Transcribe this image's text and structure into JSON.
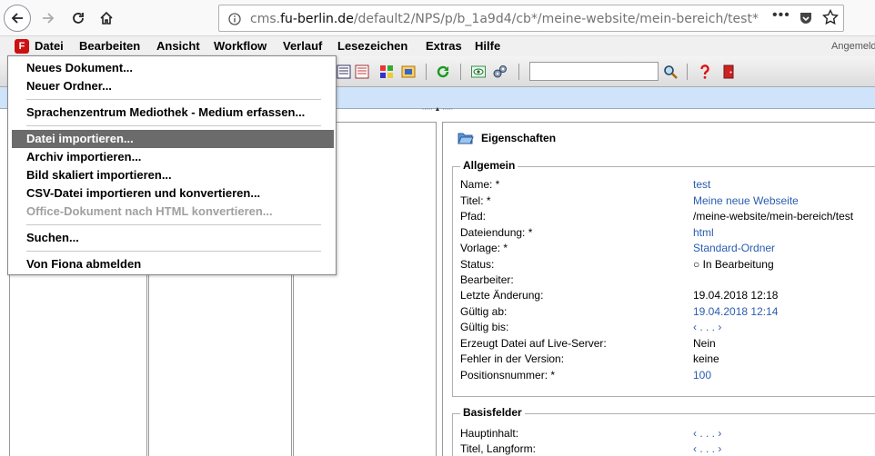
{
  "browser": {
    "url_prefix": "cms.",
    "url_host": "fu-berlin.de",
    "url_path": "/default2/NPS/p/b_1a9d4/cb*/meine-website/mein-bereich/test*",
    "page_actions": "•••"
  },
  "menubar": {
    "items": [
      "Datei",
      "Bearbeiten",
      "Ansicht",
      "Workflow",
      "Verlauf",
      "Lesezeichen",
      "Extras",
      "Hilfe"
    ],
    "user_label": "Angemeldet"
  },
  "toolbar": {
    "search_value": "",
    "splitter_glyph": "····· ▲ ·····"
  },
  "dropdown": {
    "items": [
      {
        "label": "Neues Dokument...",
        "state": "normal"
      },
      {
        "label": "Neuer Ordner...",
        "state": "normal"
      },
      {
        "label": "Sprachenzentrum Mediothek - Medium erfassen...",
        "state": "normal"
      },
      {
        "label": "Datei importieren...",
        "state": "active"
      },
      {
        "label": "Archiv importieren...",
        "state": "normal"
      },
      {
        "label": "Bild skaliert importieren...",
        "state": "normal"
      },
      {
        "label": "CSV-Datei importieren und konvertieren...",
        "state": "normal"
      },
      {
        "label": "Office-Dokument nach HTML konvertieren...",
        "state": "disabled"
      },
      {
        "label": "Suchen...",
        "state": "normal"
      },
      {
        "label": "Von Fiona abmelden",
        "state": "normal"
      }
    ]
  },
  "properties": {
    "title": "Eigenschaften",
    "allgemein": {
      "legend": "Allgemein",
      "rows": [
        {
          "label": "Name: *",
          "value": "test",
          "link": true
        },
        {
          "label": "Titel: *",
          "value": "Meine neue Webseite",
          "link": true
        },
        {
          "label": "Pfad:",
          "value": "/meine-website/mein-bereich/test",
          "link": false
        },
        {
          "label": "Dateiendung: *",
          "value": "html",
          "link": true
        },
        {
          "label": "Vorlage: *",
          "value": "Standard-Ordner",
          "link": true
        },
        {
          "label": "Status:",
          "value": "○ In Bearbeitung",
          "link": false
        },
        {
          "label": "Bearbeiter:",
          "value": "",
          "link": false
        },
        {
          "label": "Letzte Änderung:",
          "value": "19.04.2018 12:18",
          "link": false
        },
        {
          "label": "Gültig ab:",
          "value": "19.04.2018 12:14",
          "link": true
        },
        {
          "label": "Gültig bis:",
          "value": "‹ . . . ›",
          "link": true
        },
        {
          "label": "Erzeugt Datei auf Live-Server:",
          "value": "Nein",
          "link": false
        },
        {
          "label": "Fehler in der Version:",
          "value": "keine",
          "link": false
        },
        {
          "label": "Positionsnummer: *",
          "value": "100",
          "link": true
        }
      ]
    },
    "basisfelder": {
      "legend": "Basisfelder",
      "rows": [
        {
          "label": "Hauptinhalt:",
          "value": "‹ . . . ›",
          "link": true
        },
        {
          "label": "Titel, Langform:",
          "value": "‹ . . . ›",
          "link": true
        }
      ]
    }
  },
  "colors": {
    "accent": "#2a5db0",
    "menu_active": "#6b6b6b",
    "strip": "#cfe4fb",
    "logo": "#cc1111"
  }
}
